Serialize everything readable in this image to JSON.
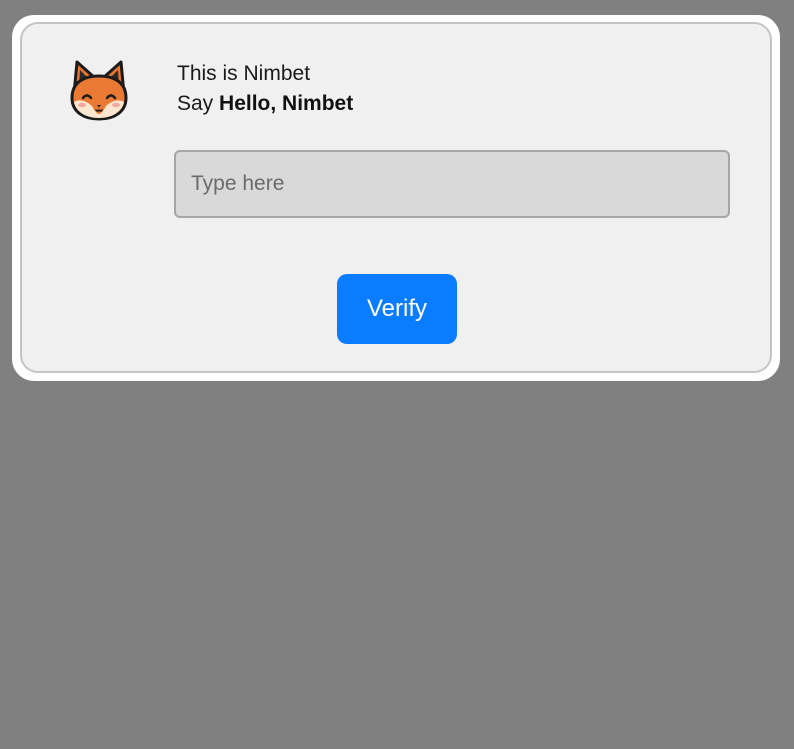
{
  "dialog": {
    "intro_line": "This is Nimbet",
    "prompt_prefix": "Say",
    "prompt_phrase": "Hello, Nimbet",
    "avatar_icon": "fox-face-icon"
  },
  "input": {
    "placeholder": "Type here",
    "value": ""
  },
  "verify_button": {
    "label": "Verify",
    "color": "#0a7cff"
  },
  "colors": {
    "backdrop": "#808080",
    "card_background": "#f0f0f0",
    "input_background": "#d9d9d9"
  }
}
